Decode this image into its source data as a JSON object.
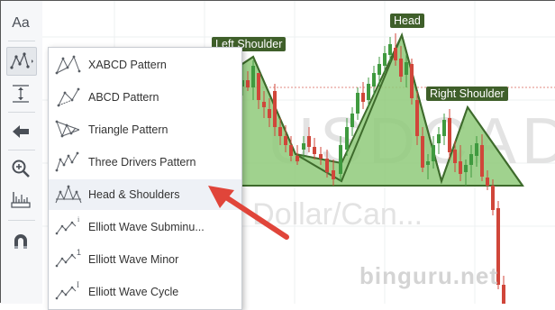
{
  "toolbar": {
    "font_label": "Aa",
    "icons": [
      "text-icon",
      "patterns-icon",
      "measure-icon",
      "back-arrow-icon",
      "zoom-icon",
      "ruler-icon",
      "magnet-icon"
    ]
  },
  "menu": {
    "items": [
      {
        "label": "XABCD Pattern",
        "icon": "xabcd-pattern-icon"
      },
      {
        "label": "ABCD Pattern",
        "icon": "abcd-pattern-icon"
      },
      {
        "label": "Triangle Pattern",
        "icon": "triangle-pattern-icon"
      },
      {
        "label": "Three Drivers Pattern",
        "icon": "three-drivers-pattern-icon"
      },
      {
        "label": "Head & Shoulders",
        "icon": "head-shoulders-icon",
        "highlighted": true
      },
      {
        "label": "Elliott Wave Subminu...",
        "icon": "elliott-subminuette-icon"
      },
      {
        "label": "Elliott Wave Minor",
        "icon": "elliott-minor-icon"
      },
      {
        "label": "Elliott Wave Cycle",
        "icon": "elliott-cycle-icon"
      }
    ]
  },
  "chart": {
    "labels": {
      "left_shoulder": "Left Shoulder",
      "head": "Head",
      "right_shoulder": "Right Shoulder"
    },
    "watermark_symbol": "USDCAD",
    "watermark_name": "...ian Dollar/Can...",
    "pattern_fill": "#8fca7a",
    "pattern_stroke": "#3e6b2c",
    "up_color": "#3f9a3f",
    "down_color": "#d0463a"
  },
  "site_watermark": "binguru.net",
  "arrow_color": "#e0453a"
}
